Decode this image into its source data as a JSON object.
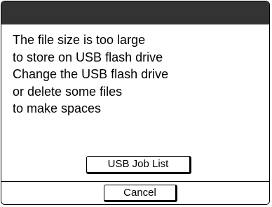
{
  "dialog": {
    "message_lines": [
      "The file size is too large",
      "to store on USB flash drive",
      "Change the USB flash drive",
      "or delete some files",
      "to make spaces"
    ],
    "usb_job_list_label": "USB Job List",
    "cancel_label": "Cancel"
  },
  "colors": {
    "title_bar": "#333333",
    "background": "#ffffff",
    "border": "#000000"
  }
}
